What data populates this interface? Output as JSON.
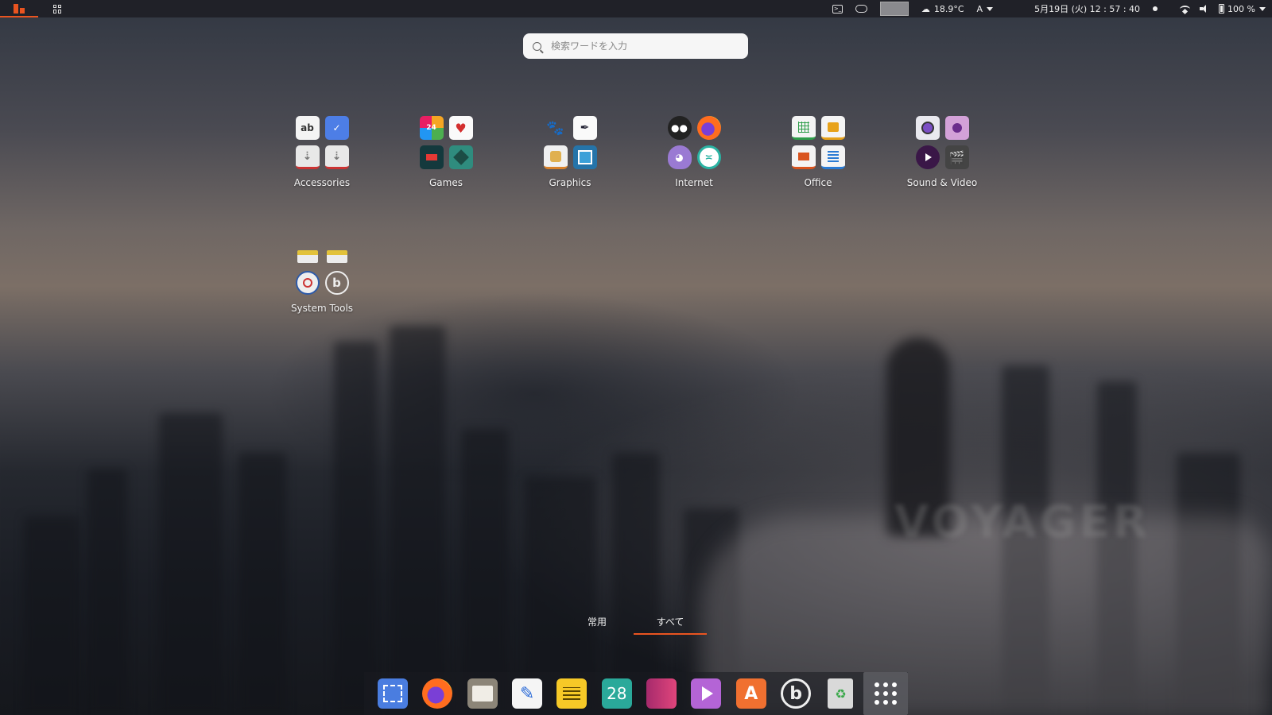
{
  "topbar": {
    "temperature": "18.9°C",
    "input_method": "A",
    "datetime": "5月19日 (火)  12 : 57 : 40",
    "battery": "100 %"
  },
  "search": {
    "placeholder": "検索ワードを入力"
  },
  "folders": [
    {
      "label": "Accessories",
      "icons": [
        "text-editor-icon",
        "todo-icon",
        "usb-creator-icon",
        "usb-creator-2-icon"
      ]
    },
    {
      "label": "Games",
      "icons": [
        "2048-icon",
        "solitaire-icon",
        "tetris-icon",
        "mahjongg-icon"
      ]
    },
    {
      "label": "Graphics",
      "icons": [
        "gimp-icon",
        "inkscape-icon",
        "image-viewer-icon",
        "shotwell-icon"
      ]
    },
    {
      "label": "Internet",
      "icons": [
        "pidgin-owl-icon",
        "firefox-icon",
        "pidgin-icon",
        "remmina-icon"
      ]
    },
    {
      "label": "Office",
      "icons": [
        "calc-icon",
        "draw-icon",
        "impress-icon",
        "writer-icon"
      ]
    },
    {
      "label": "Sound & Video",
      "icons": [
        "cheese-icon",
        "webcam-icon",
        "video-player-icon",
        "clapper-icon"
      ]
    },
    {
      "label": "System Tools",
      "icons": [
        "bleachbit-icon",
        "bleachbit-root-icon",
        "disk-usage-icon",
        "bitwarden-icon"
      ]
    }
  ],
  "tabs": [
    {
      "label": "常用",
      "active": false
    },
    {
      "label": "すべて",
      "active": true
    }
  ],
  "dock": {
    "calendar_day": "28",
    "apps": [
      "screenshot-icon",
      "firefox-icon",
      "files-icon",
      "text-editor-icon",
      "notes-icon",
      "calendar-icon",
      "app-icon",
      "video-icon",
      "software-center-icon",
      "bitwarden-icon",
      "trash-icon",
      "show-apps-icon"
    ]
  },
  "colors": {
    "accent": "#e95420"
  }
}
